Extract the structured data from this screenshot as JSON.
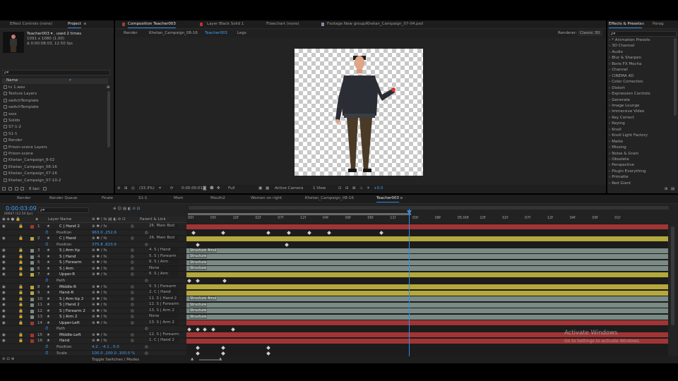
{
  "colors": {
    "accent": "#2d8ceb",
    "timecode": "#3ea0ff",
    "red_layer": "#a13535",
    "yellow_layer": "#b5a83d",
    "gray_layer": "#7a8a85"
  },
  "project": {
    "tabs": [
      "Effect Controls (none)",
      "Project"
    ],
    "selected_name": "Teacher003 ▾ , used 2 times",
    "selected_info1": "1091 x 1080 (1.00)",
    "selected_info2": "Δ 0:00:08:03, 12.50 fps",
    "search_placeholder": "ρ▾",
    "column_header": "Name",
    "items": [
      "tv 1.wav",
      "Texture Layers",
      "switchTemplate",
      "switchTemplate",
      "ssss",
      "Solids",
      "S7-1-2",
      "S1-1",
      "Render",
      "Prison-scene Layers",
      "Prison-scene",
      "Khetan_Campaign_8-02",
      "Khetan_Campaign_08-16",
      "Khetan_Campaign_07-16",
      "Khetan_Campaign_07-10-2"
    ],
    "bpc": "8 bpc"
  },
  "composition": {
    "tabs": [
      "Composition Teacher003",
      "Layer Black Solid 1",
      "Flowchart (none)",
      "Footage New group/Khetan_Campaign_07-04.psd"
    ],
    "breadcrumbs": [
      "Render",
      "Khetan_Campaign_08-16",
      "Teacher003",
      "Legs"
    ],
    "renderer_label": "Renderer:",
    "renderer_value": "Classic 3D",
    "zoom": "(33.3%)",
    "timecode": "0:00:00:01",
    "quality": "Full",
    "camera": "Active Camera",
    "views": "1 View",
    "exposure": "+0.0"
  },
  "effects": {
    "tabs": [
      "Effects & Presets",
      "Parag"
    ],
    "search_placeholder": "ρ▾",
    "items": [
      "* Animation Presets",
      "3D Channel",
      "Audio",
      "Blur & Sharpen",
      "Boris FX Mocha",
      "Channel",
      "CINEMA 4D",
      "Color Correction",
      "Distort",
      "Expression Controls",
      "Generate",
      "Image Lounge",
      "Immersive Video",
      "Key Correct",
      "Keying",
      "Knoll",
      "Knoll Light Factory",
      "Matte",
      "Missing",
      "Noise & Grain",
      "Obsolete",
      "Perspective",
      "Plugin Everything",
      "Primatte",
      "Red Giant"
    ]
  },
  "timeline": {
    "tabs": [
      "Render",
      "Render Queue",
      "Finale",
      "S1-1",
      "Mom",
      "Mouth2",
      "Women on right",
      "Khetan_Campaign_08-16",
      "Teacher003"
    ],
    "current_time": "0:00:03:09",
    "frame_info": "00047 (12.50 fps)",
    "search_placeholder": "ρ▾",
    "col_layer_name": "Layer Name",
    "col_parent": "Parent & Link",
    "ruler": [
      "00f",
      "05f",
      "10f",
      "02f",
      "07f",
      "12f",
      "04f",
      "09f",
      "06f",
      "11f",
      "03f",
      "08f",
      "05:00f",
      "10f",
      "02f",
      "07f",
      "12f",
      "04f",
      "09f",
      "01f"
    ],
    "toggle_label": "Toggle Switches / Modes",
    "layers": [
      {
        "num": "1",
        "name": "C | Hand 2",
        "parent": "26. Main Bod",
        "color": "red",
        "bar": "red"
      },
      {
        "num": "",
        "name": "Position",
        "value": "963.0 ,252.6",
        "prop": true
      },
      {
        "num": "2",
        "name": "C | Hand",
        "parent": "26. Main Bod",
        "color": "yellow",
        "bar": "yellow"
      },
      {
        "num": "",
        "name": "Position",
        "value": "375.8 ,623.6",
        "prop": true
      },
      {
        "num": "3",
        "name": "S | Arm tip",
        "parent": "4. S | Hand",
        "color": "gray",
        "bar": "gray",
        "label": "Structure 4mul"
      },
      {
        "num": "4",
        "name": "S | Hand",
        "parent": "5. S | Forearm",
        "color": "gray",
        "bar": "gray",
        "label": "Structure"
      },
      {
        "num": "5",
        "name": "S | Forearm",
        "parent": "6. S | Arm",
        "color": "gray",
        "bar": "gray",
        "label": "Structure"
      },
      {
        "num": "6",
        "name": "S | Arm",
        "parent": "None",
        "color": "gray",
        "bar": "gray",
        "label": "Structure"
      },
      {
        "num": "7",
        "name": "Upper-R",
        "parent": "6. S | Arm",
        "color": "yellow",
        "bar": "yellow"
      },
      {
        "num": "",
        "name": "Path",
        "value": "",
        "prop": true
      },
      {
        "num": "8",
        "name": "Middle-R",
        "parent": "5. S | Forearm",
        "color": "yellow",
        "bar": "yellow"
      },
      {
        "num": "9",
        "name": "Hand-R",
        "parent": "2. C | Hand",
        "color": "yellow",
        "bar": "yellow"
      },
      {
        "num": "10",
        "name": "S | Arm tip 2",
        "parent": "11. S | Hand 2",
        "color": "gray",
        "bar": "gray",
        "label": "Structure 4mul"
      },
      {
        "num": "11",
        "name": "S | Hand 2",
        "parent": "12. S | Forearm",
        "color": "gray",
        "bar": "gray",
        "label": "Structure"
      },
      {
        "num": "12",
        "name": "S | Forearm 2",
        "parent": "13. S | Arm 2",
        "color": "gray",
        "bar": "gray",
        "label": "Structure"
      },
      {
        "num": "13",
        "name": "S | Arm 2",
        "parent": "None",
        "color": "gray",
        "bar": "gray",
        "label": "Structure"
      },
      {
        "num": "14",
        "name": "Upper-Left",
        "parent": "13. S | Arm 2",
        "color": "red",
        "bar": "red"
      },
      {
        "num": "",
        "name": "Path",
        "value": "",
        "prop": true
      },
      {
        "num": "15",
        "name": "Middle-Left",
        "parent": "12. S | Forearm",
        "color": "red",
        "bar": "red"
      },
      {
        "num": "16",
        "name": "Hand",
        "parent": "1. C | Hand 2",
        "color": "red",
        "bar": "red"
      },
      {
        "num": "",
        "name": "Position",
        "value": "4.2 , -4.1 , 0.0",
        "prop": true
      },
      {
        "num": "",
        "name": "Scale",
        "value": "100.0 ,100.0 ,100.0 %",
        "prop": true
      }
    ]
  },
  "watermark": {
    "title": "Activate Windows",
    "subtitle": "Go to Settings to activate Windows."
  }
}
